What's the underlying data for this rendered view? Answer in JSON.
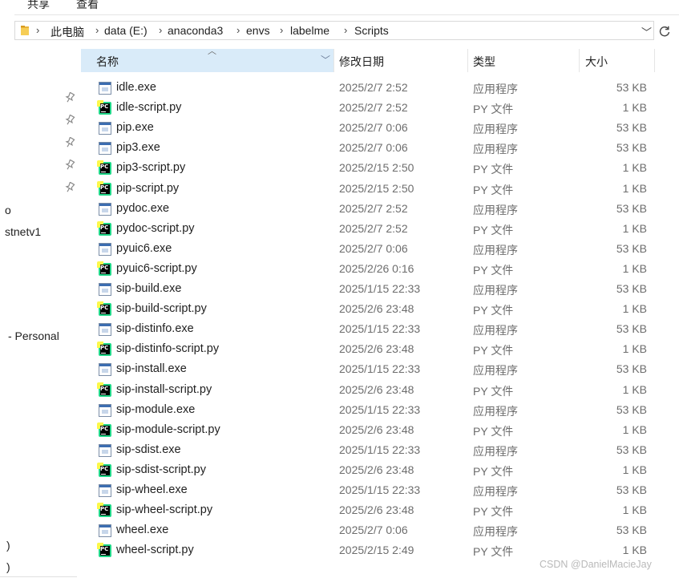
{
  "ribbon": {
    "tabs": [
      "共享",
      "查看"
    ]
  },
  "address_bar": {
    "breadcrumbs": [
      "此电脑",
      "data (E:)",
      "anaconda3",
      "envs",
      "labelme",
      "Scripts"
    ]
  },
  "columns": {
    "name": "名称",
    "date": "修改日期",
    "type": "类型",
    "size": "大小"
  },
  "nav_pane": {
    "items": [
      "o",
      "stnetv1",
      "- Personal",
      ")",
      ")"
    ]
  },
  "files": [
    {
      "name": "idle.exe",
      "date": "2025/2/7 2:52",
      "type": "应用程序",
      "size": "53 KB",
      "kind": "exe"
    },
    {
      "name": "idle-script.py",
      "date": "2025/2/7 2:52",
      "type": "PY 文件",
      "size": "1 KB",
      "kind": "py"
    },
    {
      "name": "pip.exe",
      "date": "2025/2/7 0:06",
      "type": "应用程序",
      "size": "53 KB",
      "kind": "exe"
    },
    {
      "name": "pip3.exe",
      "date": "2025/2/7 0:06",
      "type": "应用程序",
      "size": "53 KB",
      "kind": "exe"
    },
    {
      "name": "pip3-script.py",
      "date": "2025/2/15 2:50",
      "type": "PY 文件",
      "size": "1 KB",
      "kind": "py"
    },
    {
      "name": "pip-script.py",
      "date": "2025/2/15 2:50",
      "type": "PY 文件",
      "size": "1 KB",
      "kind": "py"
    },
    {
      "name": "pydoc.exe",
      "date": "2025/2/7 2:52",
      "type": "应用程序",
      "size": "53 KB",
      "kind": "exe"
    },
    {
      "name": "pydoc-script.py",
      "date": "2025/2/7 2:52",
      "type": "PY 文件",
      "size": "1 KB",
      "kind": "py"
    },
    {
      "name": "pyuic6.exe",
      "date": "2025/2/7 0:06",
      "type": "应用程序",
      "size": "53 KB",
      "kind": "exe"
    },
    {
      "name": "pyuic6-script.py",
      "date": "2025/2/26 0:16",
      "type": "PY 文件",
      "size": "1 KB",
      "kind": "py"
    },
    {
      "name": "sip-build.exe",
      "date": "2025/1/15 22:33",
      "type": "应用程序",
      "size": "53 KB",
      "kind": "exe"
    },
    {
      "name": "sip-build-script.py",
      "date": "2025/2/6 23:48",
      "type": "PY 文件",
      "size": "1 KB",
      "kind": "py"
    },
    {
      "name": "sip-distinfo.exe",
      "date": "2025/1/15 22:33",
      "type": "应用程序",
      "size": "53 KB",
      "kind": "exe"
    },
    {
      "name": "sip-distinfo-script.py",
      "date": "2025/2/6 23:48",
      "type": "PY 文件",
      "size": "1 KB",
      "kind": "py"
    },
    {
      "name": "sip-install.exe",
      "date": "2025/1/15 22:33",
      "type": "应用程序",
      "size": "53 KB",
      "kind": "exe"
    },
    {
      "name": "sip-install-script.py",
      "date": "2025/2/6 23:48",
      "type": "PY 文件",
      "size": "1 KB",
      "kind": "py"
    },
    {
      "name": "sip-module.exe",
      "date": "2025/1/15 22:33",
      "type": "应用程序",
      "size": "53 KB",
      "kind": "exe"
    },
    {
      "name": "sip-module-script.py",
      "date": "2025/2/6 23:48",
      "type": "PY 文件",
      "size": "1 KB",
      "kind": "py"
    },
    {
      "name": "sip-sdist.exe",
      "date": "2025/1/15 22:33",
      "type": "应用程序",
      "size": "53 KB",
      "kind": "exe"
    },
    {
      "name": "sip-sdist-script.py",
      "date": "2025/2/6 23:48",
      "type": "PY 文件",
      "size": "1 KB",
      "kind": "py"
    },
    {
      "name": "sip-wheel.exe",
      "date": "2025/1/15 22:33",
      "type": "应用程序",
      "size": "53 KB",
      "kind": "exe"
    },
    {
      "name": "sip-wheel-script.py",
      "date": "2025/2/6 23:48",
      "type": "PY 文件",
      "size": "1 KB",
      "kind": "py"
    },
    {
      "name": "wheel.exe",
      "date": "2025/2/7 0:06",
      "type": "应用程序",
      "size": "53 KB",
      "kind": "exe"
    },
    {
      "name": "wheel-script.py",
      "date": "2025/2/15 2:49",
      "type": "PY 文件",
      "size": "1 KB",
      "kind": "py"
    }
  ],
  "watermark": "CSDN @DanielMacieJay"
}
